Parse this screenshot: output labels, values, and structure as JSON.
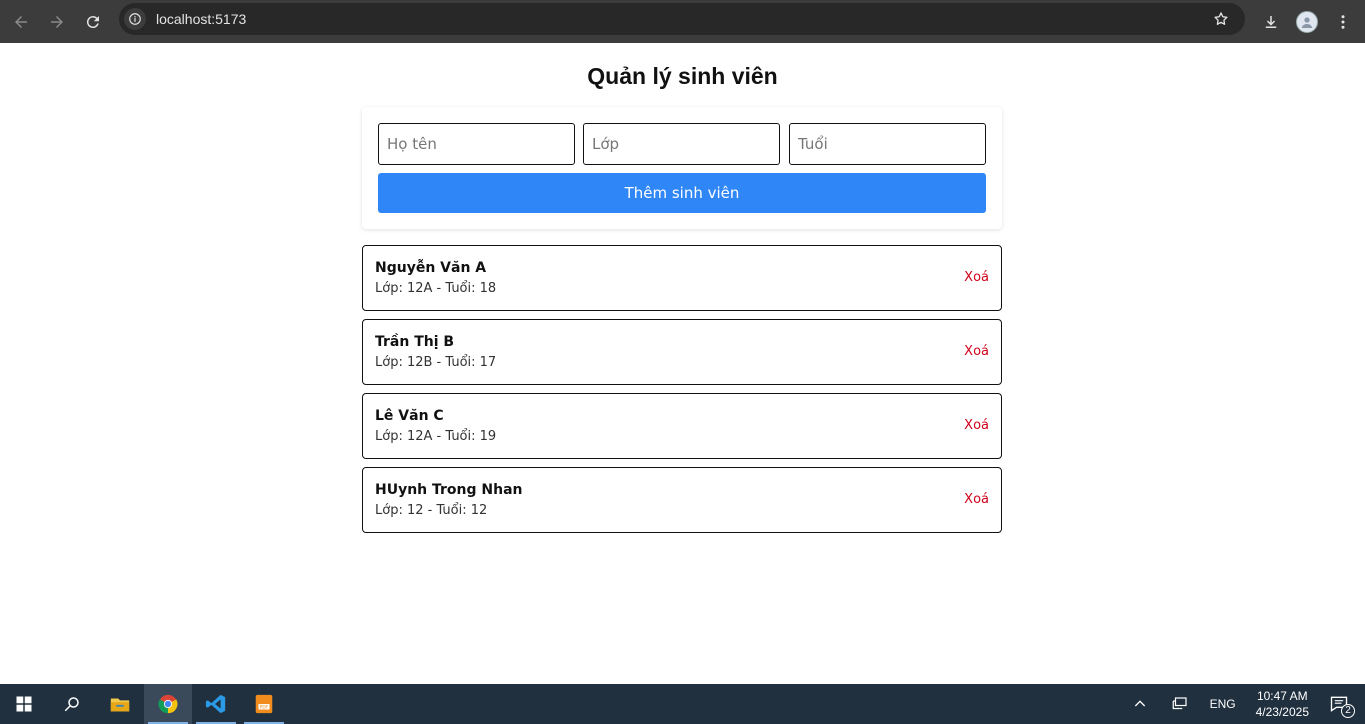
{
  "browser": {
    "url": "localhost:5173"
  },
  "app": {
    "title": "Quản lý sinh viên",
    "form": {
      "name_placeholder": "Họ tên",
      "class_placeholder": "Lớp",
      "age_placeholder": "Tuổi",
      "submit_label": "Thêm sinh viên"
    },
    "students": [
      {
        "name": "Nguyễn Văn A",
        "meta": "Lớp: 12A - Tuổi: 18",
        "delete_label": "Xoá"
      },
      {
        "name": "Trần Thị B",
        "meta": "Lớp: 12B - Tuổi: 17",
        "delete_label": "Xoá"
      },
      {
        "name": "Lê Văn C",
        "meta": "Lớp: 12A - Tuổi: 19",
        "delete_label": "Xoá"
      },
      {
        "name": "HUynh Trong Nhan",
        "meta": "Lớp: 12 - Tuổi: 12",
        "delete_label": "Xoá"
      }
    ]
  },
  "taskbar": {
    "language": "ENG",
    "time": "10:47 AM",
    "date": "4/23/2025",
    "notification_count": "2"
  },
  "colors": {
    "accent": "#2f86f6",
    "delete": "#d0021b",
    "taskbar": "#20303f",
    "chrome": "#3c3c3c"
  }
}
